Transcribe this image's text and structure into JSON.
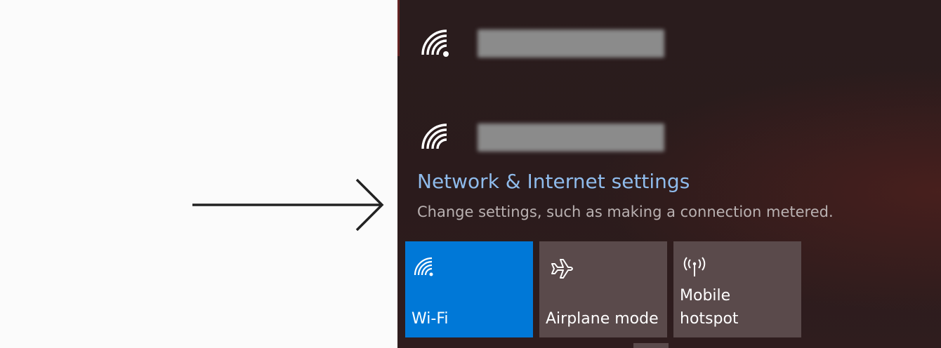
{
  "networks": [
    {
      "icon": "wifi-signal-icon",
      "name": ""
    },
    {
      "icon": "wifi-signal-icon",
      "name": ""
    }
  ],
  "network_settings": {
    "title": "Network & Internet settings",
    "subtitle": "Change settings, such as making a connection metered."
  },
  "quick_actions": [
    {
      "label": "Wi-Fi",
      "icon": "wifi-icon",
      "active": true
    },
    {
      "label": "Airplane mode",
      "icon": "airplane-icon",
      "active": false
    },
    {
      "label": "Mobile\nhotspot",
      "icon": "mobile-hotspot-icon",
      "active": false
    }
  ],
  "colors": {
    "accent": "#0078d7",
    "link": "#8fbbeb",
    "tile_inactive": "#5a4a4b",
    "flyout_bg": "#2a1c1d"
  }
}
